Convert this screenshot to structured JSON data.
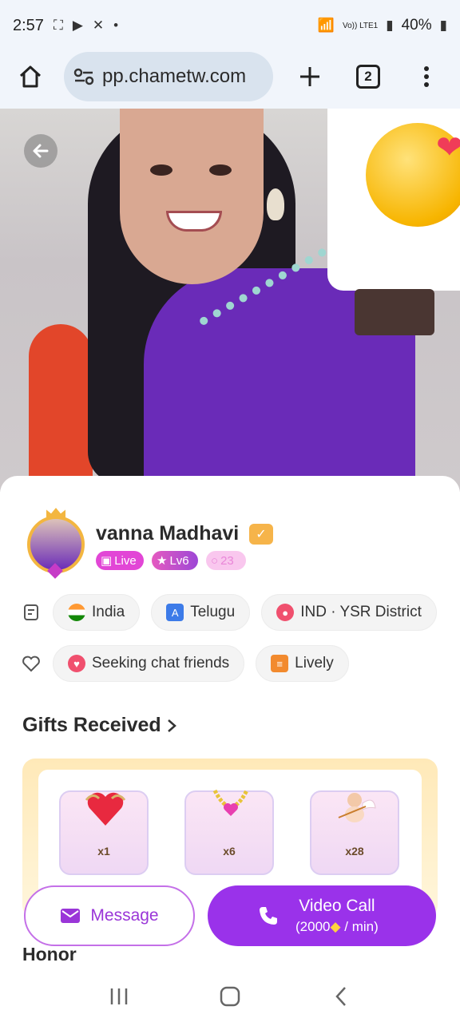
{
  "status_bar": {
    "time": "2:57",
    "battery": "40%",
    "network_label": "Vo)) LTE1"
  },
  "browser": {
    "url": "pp.chametw.com",
    "tab_count": "2"
  },
  "profile": {
    "name": "vanna Madhavi",
    "badges": {
      "live": "Live",
      "level": "Lv6",
      "count": "23"
    },
    "info_chips": [
      {
        "label": "India",
        "icon": "india-flag-icon"
      },
      {
        "label": "Telugu",
        "icon": "language-icon"
      },
      {
        "label": "IND · YSR District",
        "icon": "location-pin-icon"
      }
    ],
    "interest_chips": [
      {
        "label": "Seeking chat friends",
        "icon": "heart-icon"
      },
      {
        "label": "Lively",
        "icon": "lively-icon"
      }
    ]
  },
  "gifts": {
    "title": "Gifts Received",
    "items": [
      {
        "name": "heart-gift",
        "count": "x1"
      },
      {
        "name": "necklace-gift",
        "count": "x6"
      },
      {
        "name": "cupid-gift",
        "count": "x28"
      }
    ]
  },
  "actions": {
    "message_label": "Message",
    "video_call_label": "Video Call",
    "video_call_price_prefix": "(2000",
    "video_call_price_suffix": " / min)"
  },
  "section_next": {
    "title": "Honor"
  },
  "colors": {
    "accent_purple": "#9a32ea",
    "live_pink": "#e246d6",
    "gold": "#f3b640"
  }
}
